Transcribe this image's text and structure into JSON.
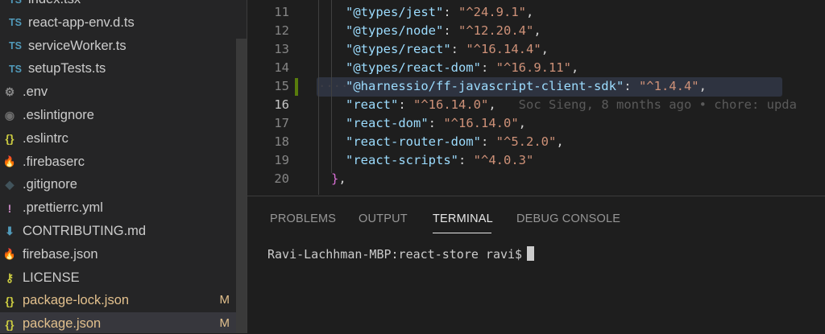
{
  "sidebar": {
    "items": [
      {
        "name": "index.tsx",
        "icon": "typescript-icon",
        "glyph": "TS"
      },
      {
        "name": "react-app-env.d.ts",
        "icon": "typescript-icon",
        "glyph": "TS"
      },
      {
        "name": "serviceWorker.ts",
        "icon": "typescript-icon",
        "glyph": "TS"
      },
      {
        "name": "setupTests.ts",
        "icon": "typescript-icon",
        "glyph": "TS"
      },
      {
        "name": ".env",
        "icon": "gear-icon",
        "glyph": "⚙"
      },
      {
        "name": ".eslintignore",
        "icon": "circle-icon",
        "glyph": "◉"
      },
      {
        "name": ".eslintrc",
        "icon": "json-braces-icon",
        "glyph": "{}"
      },
      {
        "name": ".firebaserc",
        "icon": "firebase-flame-icon",
        "glyph": "🔥"
      },
      {
        "name": ".gitignore",
        "icon": "git-diamond-icon",
        "glyph": "◆"
      },
      {
        "name": ".prettierrc.yml",
        "icon": "exclamation-icon",
        "glyph": "!"
      },
      {
        "name": "CONTRIBUTING.md",
        "icon": "download-arrow-icon",
        "glyph": "⬇"
      },
      {
        "name": "firebase.json",
        "icon": "firebase-flame-icon",
        "glyph": "🔥"
      },
      {
        "name": "LICENSE",
        "icon": "key-icon",
        "glyph": "⚷"
      },
      {
        "name": "package-lock.json",
        "icon": "json-braces-icon",
        "glyph": "{}",
        "badge": "M"
      },
      {
        "name": "package.json",
        "icon": "json-braces-icon",
        "glyph": "{}",
        "badge": "M"
      }
    ]
  },
  "editor": {
    "active_line": "16",
    "lines": [
      {
        "no": "11",
        "key": "\"@types/jest\"",
        "sep": ": ",
        "val": "\"^24.9.1\"",
        "end": ","
      },
      {
        "no": "12",
        "key": "\"@types/node\"",
        "sep": ": ",
        "val": "\"^12.20.4\"",
        "end": ","
      },
      {
        "no": "13",
        "key": "\"@types/react\"",
        "sep": ": ",
        "val": "\"^16.14.4\"",
        "end": ","
      },
      {
        "no": "14",
        "key": "\"@types/react-dom\"",
        "sep": ": ",
        "val": "\"^16.9.11\"",
        "end": ","
      },
      {
        "no": "15",
        "key": "\"@harnessio/ff-javascript-client-sdk\"",
        "sep": ": ",
        "val": "\"^1.4.4\"",
        "end": ","
      },
      {
        "no": "16",
        "key": "\"react\"",
        "sep": ": ",
        "val": "\"^16.14.0\"",
        "end": ",",
        "blame": "Soc Sieng, 8 months ago • chore: upda"
      },
      {
        "no": "17",
        "key": "\"react-dom\"",
        "sep": ": ",
        "val": "\"^16.14.0\"",
        "end": ","
      },
      {
        "no": "18",
        "key": "\"react-router-dom\"",
        "sep": ": ",
        "val": "\"^5.2.0\"",
        "end": ","
      },
      {
        "no": "19",
        "key": "\"react-scripts\"",
        "sep": ": ",
        "val": "\"^4.0.3\"",
        "end": ""
      },
      {
        "no": "20",
        "brace": "}",
        "end": ","
      }
    ],
    "whitespace_dots": "····"
  },
  "panel": {
    "tabs": [
      "PROBLEMS",
      "OUTPUT",
      "TERMINAL",
      "DEBUG CONSOLE"
    ],
    "active_tab": "TERMINAL",
    "terminal_prompt": "Ravi-Lachhman-MBP:react-store ravi$"
  },
  "colors": {
    "json_key": "#9cdcfe",
    "json_string": "#ce9178",
    "modified": "#e2c08d",
    "gutter_modified": "#587c0c"
  }
}
